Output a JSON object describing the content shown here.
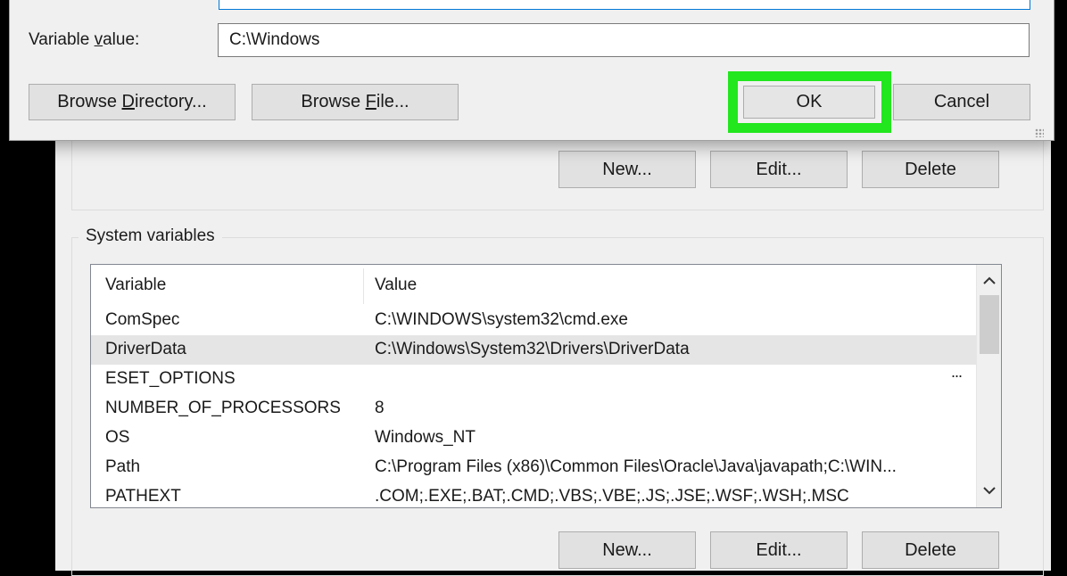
{
  "dialog": {
    "variable_value_label": "Variable value:",
    "variable_value_accel": "v",
    "variable_value": "C:\\Windows",
    "browse_directory_label": "Browse Directory...",
    "browse_file_label": "Browse File...",
    "ok_label": "OK",
    "cancel_label": "Cancel",
    "highlight_color": "#22e61e"
  },
  "user_variables": {
    "new_label": "New...",
    "edit_label": "Edit...",
    "delete_label": "Delete"
  },
  "system_variables": {
    "title": "System variables",
    "columns": [
      "Variable",
      "Value"
    ],
    "rows": [
      {
        "variable": "ComSpec",
        "value": "C:\\WINDOWS\\system32\\cmd.exe"
      },
      {
        "variable": "DriverData",
        "value": "C:\\Windows\\System32\\Drivers\\DriverData"
      },
      {
        "variable": "ESET_OPTIONS",
        "value": ""
      },
      {
        "variable": "NUMBER_OF_PROCESSORS",
        "value": "8"
      },
      {
        "variable": "OS",
        "value": "Windows_NT"
      },
      {
        "variable": "Path",
        "value": "C:\\Program Files (x86)\\Common Files\\Oracle\\Java\\javapath;C:\\WIN..."
      },
      {
        "variable": "PATHEXT",
        "value": ".COM;.EXE;.BAT;.CMD;.VBS;.VBE;.JS;.JSE;.WSF;.WSH;.MSC"
      }
    ],
    "selected_row": 1,
    "ellipsis": "...",
    "new_label": "New...",
    "edit_label": "Edit...",
    "delete_label": "Delete"
  },
  "icons": {
    "scroll_up": "chevron-up-icon",
    "scroll_down": "chevron-down-icon",
    "resize": "resize-grip-icon"
  }
}
